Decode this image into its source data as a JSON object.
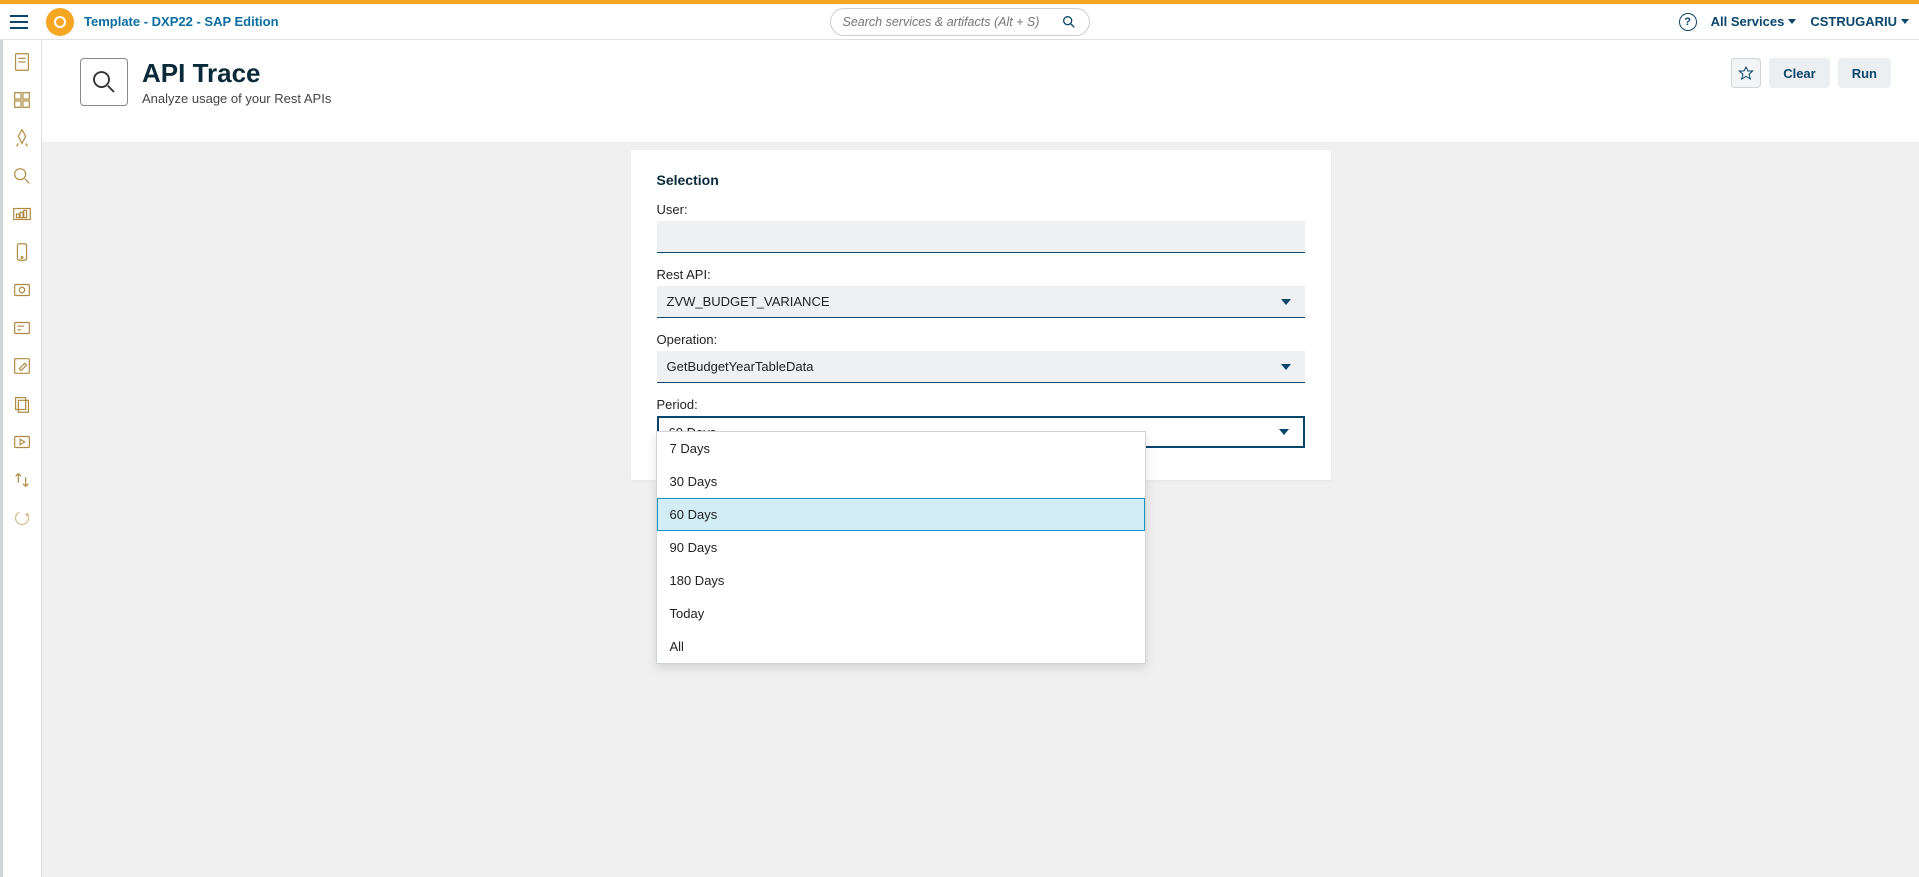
{
  "header": {
    "breadcrumb": "Template  - DXP22 - SAP Edition",
    "search_placeholder": "Search services & artifacts (Alt + S)",
    "all_services": "All Services",
    "username": "CSTRUGARIU"
  },
  "page": {
    "title": "API Trace",
    "subtitle": "Analyze usage of your Rest APIs",
    "clear_label": "Clear",
    "run_label": "Run"
  },
  "form": {
    "section_title": "Selection",
    "labels": {
      "user": "User:",
      "rest_api": "Rest API:",
      "operation": "Operation:",
      "period": "Period:"
    },
    "values": {
      "user": "",
      "rest_api": "ZVW_BUDGET_VARIANCE",
      "operation": "GetBudgetYearTableData",
      "period": "60 Days"
    },
    "period_options": [
      "7 Days",
      "30 Days",
      "60 Days",
      "90 Days",
      "180 Days",
      "Today",
      "All"
    ],
    "period_selected_index": 2
  }
}
